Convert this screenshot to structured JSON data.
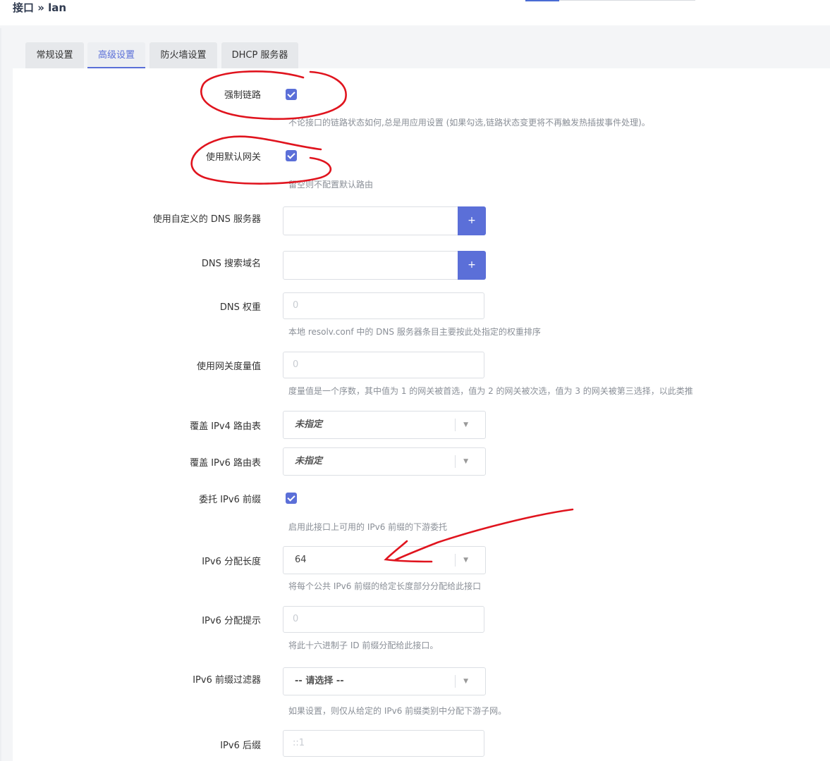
{
  "header": {
    "breadcrumb": "接口 » lan"
  },
  "tabs": [
    {
      "label": "常规设置",
      "active": false
    },
    {
      "label": "高级设置",
      "active": true
    },
    {
      "label": "防火墙设置",
      "active": false
    },
    {
      "label": "DHCP 服务器",
      "active": false
    }
  ],
  "form": {
    "force_link": {
      "label": "强制链路",
      "checked": true,
      "desc": "不论接口的链路状态如何,总是用应用设置 (如果勾选,链路状态变更将不再触发热插拔事件处理)。"
    },
    "default_gw": {
      "label": "使用默认网关",
      "checked": true,
      "desc": "留空则不配置默认路由"
    },
    "custom_dns": {
      "label": "使用自定义的 DNS 服务器",
      "value": "",
      "button": "+"
    },
    "dns_search": {
      "label": "DNS 搜索域名",
      "value": "",
      "button": "+"
    },
    "dns_weight": {
      "label": "DNS 权重",
      "placeholder": "0",
      "desc": "本地 resolv.conf 中的 DNS 服务器条目主要按此处指定的权重排序"
    },
    "gw_metric": {
      "label": "使用网关度量值",
      "placeholder": "0",
      "desc": "度量值是一个序数，其中值为 1 的网关被首选，值为 2 的网关被次选，值为 3 的网关被第三选择，以此类推"
    },
    "ipv4_table": {
      "label": "覆盖 IPv4 路由表",
      "value": "未指定"
    },
    "ipv6_table": {
      "label": "覆盖 IPv6 路由表",
      "value": "未指定"
    },
    "delegate": {
      "label": "委托 IPv6 前缀",
      "checked": true,
      "desc": "启用此接口上可用的 IPv6 前缀的下游委托"
    },
    "ip6assign": {
      "label": "IPv6 分配长度",
      "value": "64",
      "desc": "将每个公共 IPv6 前缀的给定长度部分分配给此接口"
    },
    "ip6hint": {
      "label": "IPv6 分配提示",
      "placeholder": "0",
      "desc": "将此十六进制子 ID 前缀分配给此接口。"
    },
    "ip6class": {
      "label": "IPv6 前缀过滤器",
      "value": "-- 请选择 --",
      "desc": "如果设置，则仅从给定的 IPv6 前缀类别中分配下游子网。"
    },
    "ip6ifaceid": {
      "label": "IPv6 后缀",
      "placeholder": "::1"
    }
  },
  "colors": {
    "accent": "#5b6fd8",
    "annotation": "#e0141e"
  },
  "icons": {
    "check": "check-icon",
    "dropdown": "chevron-down-icon"
  }
}
